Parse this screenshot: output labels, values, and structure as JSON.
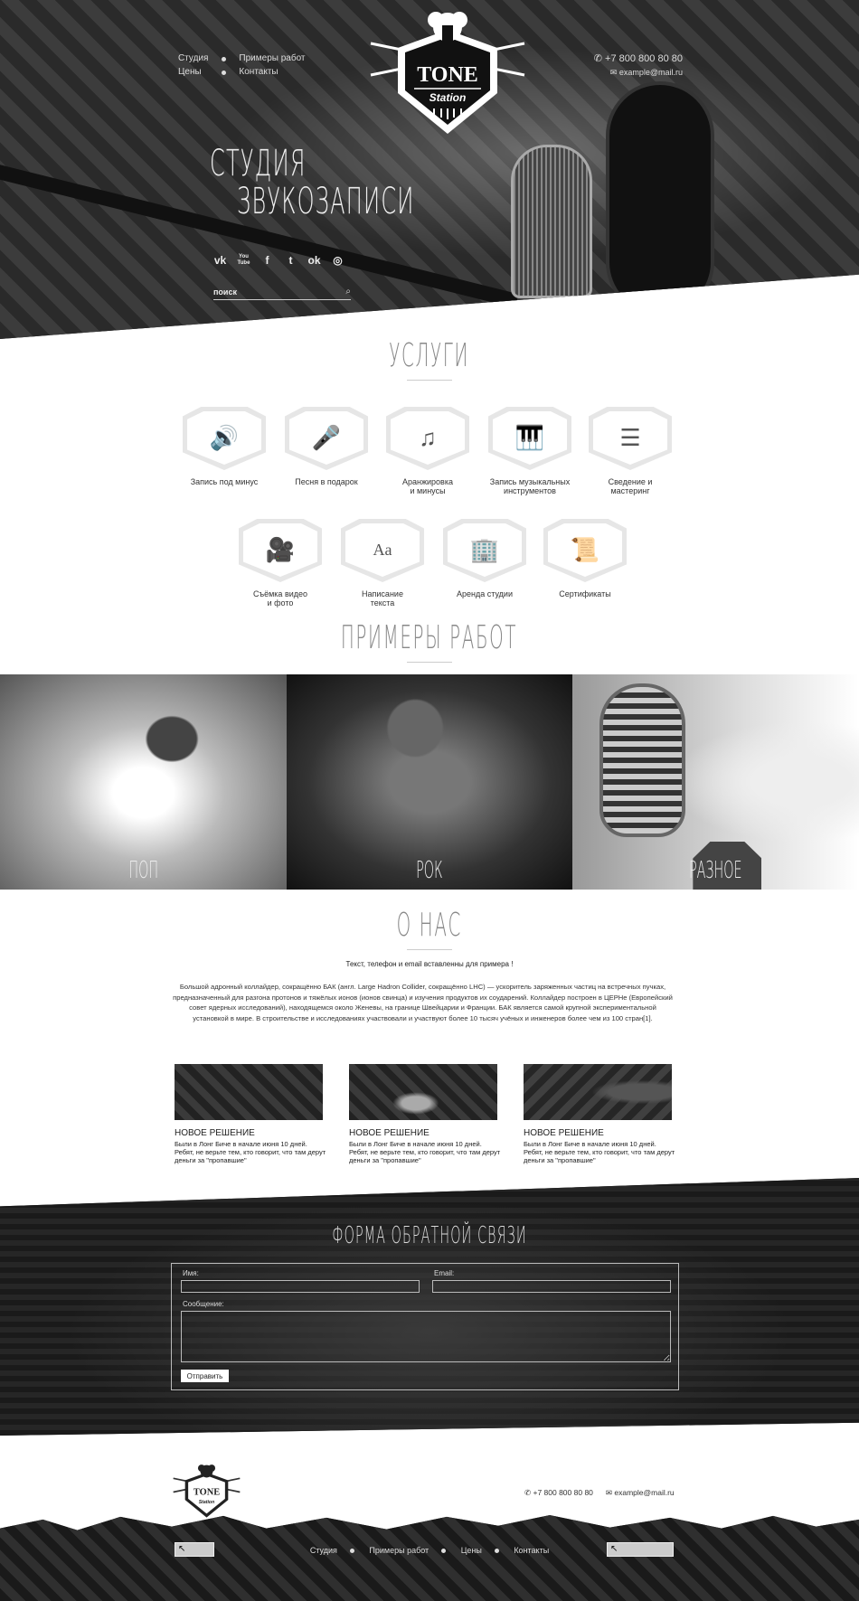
{
  "nav": {
    "items": [
      "Студия",
      "Примеры работ",
      "Цены",
      "Контакты"
    ]
  },
  "logo": {
    "line1": "TONE",
    "line2": "Station"
  },
  "contacts": {
    "phone": "+7 800 800 80 80",
    "email": "example@mail.ru"
  },
  "hero": {
    "title_line1": "СТУДИЯ",
    "title_line2": "ЗВУКОЗАПИСИ",
    "socials": [
      "vk-icon",
      "youtube-icon",
      "facebook-icon",
      "twitter-icon",
      "odnoklassniki-icon",
      "instagram-icon"
    ],
    "social_glyphs": [
      "vk",
      "You\nTube",
      "f",
      "t",
      "ok",
      "◎"
    ],
    "search_placeholder": "поиск"
  },
  "services": {
    "title": "УСЛУГИ",
    "items": [
      {
        "label": "Запись под минус",
        "icon": "speaker-icon",
        "glyph": "🔊"
      },
      {
        "label": "Песня в подарок",
        "icon": "microphone-icon",
        "glyph": "🎤"
      },
      {
        "label": "Аранжировка\nи минусы",
        "icon": "music-note-icon",
        "glyph": "♫"
      },
      {
        "label": "Запись музыкальных\nинструментов",
        "icon": "keyboard-icon",
        "glyph": "🎹"
      },
      {
        "label": "Сведение и\nмастеринг",
        "icon": "sliders-icon",
        "glyph": "☰"
      },
      {
        "label": "Съёмка видео\nи фото",
        "icon": "video-camera-icon",
        "glyph": "🎥"
      },
      {
        "label": "Написание\nтекста",
        "icon": "text-icon",
        "glyph": "Aa"
      },
      {
        "label": "Аренда студии",
        "icon": "building-icon",
        "glyph": "🏢"
      },
      {
        "label": "Сертификаты",
        "icon": "certificate-icon",
        "glyph": "📜"
      }
    ]
  },
  "works": {
    "title": "ПРИМЕРЫ РАБОТ",
    "items": [
      "ПОП",
      "РОК",
      "РАЗНОЕ"
    ]
  },
  "about": {
    "title": "О НАС",
    "lead": "Текст, телефон и email вставленны для примера !",
    "text": "Большой адронный коллайдер, сокращённо БАК (англ. Large Hadron Collider, сокращённо LHC) — ускоритель заряженных частиц на встречных пучках, предназначенный для разгона протонов и тяжёлых ионов (ионов свинца) и изучения продуктов их соударений. Коллайдер построен в ЦЕРНе (Европейский совет ядерных исследований), находящемся около Женевы, на границе Швейцарии и Франции. БАК является самой крупной экспериментальной установкой в мире. В строительстве и исследованиях участвовали и участвуют более 10 тысяч учёных и инженеров более чем из 100 стран[1].",
    "news": [
      {
        "title": "НОВОЕ РЕШЕНИЕ",
        "text": "Были в Лонг Биче в начале июня 10 дней. Ребят, не верьте тем, кто говорит, что там дерут деньги за  \"пропавшие\""
      },
      {
        "title": "НОВОЕ РЕШЕНИЕ",
        "text": "Были в Лонг Биче в начале июня 10 дней. Ребят, не верьте тем, кто говорит, что там дерут деньги за  \"пропавшие\""
      },
      {
        "title": "НОВОЕ РЕШЕНИЕ",
        "text": "Были в Лонг Биче в начале июня 10 дней. Ребят, не верьте тем, кто говорит, что там дерут деньги за  \"пропавшие\""
      }
    ]
  },
  "feedback": {
    "title": "ФОРМА ОБРАТНОЙ СВЯЗИ",
    "name_label": "Имя:",
    "email_label": "Email:",
    "message_label": "Сообщение:",
    "submit": "Отправить"
  },
  "footer": {
    "nav": [
      "Студия",
      "Примеры работ",
      "Цены",
      "Контакты"
    ]
  }
}
